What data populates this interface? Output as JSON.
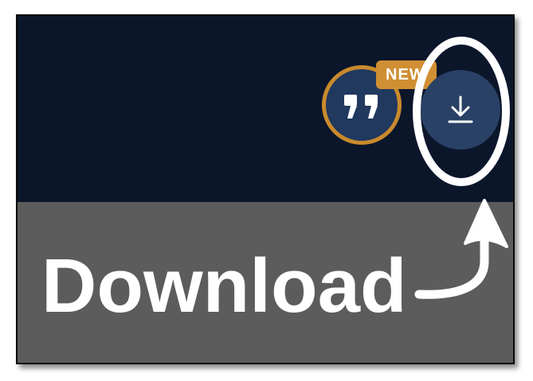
{
  "toolbar": {
    "quote_icon": "quote-icon",
    "new_badge": "NEW",
    "download_icon": "download-icon"
  },
  "annotation": {
    "callout_text": "Download"
  },
  "colors": {
    "header_background": "#0b162b",
    "lower_background": "#5c5c5c",
    "button_fill": "#2a4166",
    "badge_orange": "#d08f33",
    "annotation_white": "#ffffff"
  }
}
